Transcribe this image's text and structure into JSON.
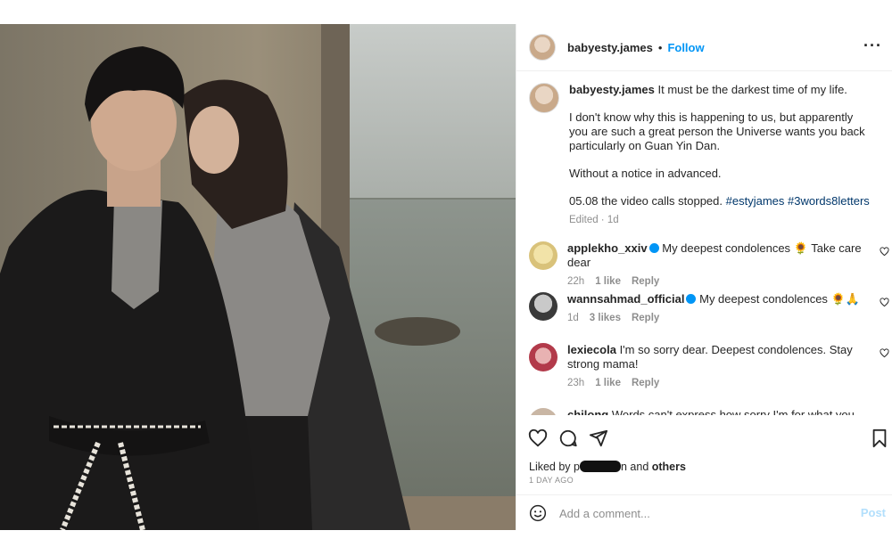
{
  "post": {
    "username": "babyesty.james",
    "follow_label": "Follow",
    "separator": "•",
    "more_label": "···"
  },
  "caption": {
    "username": "babyesty.james",
    "line1": "It must be the darkest time of my life.",
    "para2": "I don't know why this is happening to us, but apparently you are such a great person the Universe wants you back particularly on Guan Yin Dan.",
    "para3": "Without a notice in advanced.",
    "para4_text": "05.08 the video calls stopped.",
    "hashtag1": "#estyjames",
    "hashtag2": "#3words8letters",
    "meta": "Edited · 1d"
  },
  "comments": [
    {
      "username": "applekho_xxiv",
      "verified": true,
      "text": "My deepest condolences 🌻 Take care dear",
      "time": "22h",
      "likes": "1 like",
      "reply": "Reply"
    },
    {
      "username": "wannsahmad_official",
      "verified": true,
      "text": "My deepest condolences 🌻🙏",
      "time": "1d",
      "likes": "3 likes",
      "reply": "Reply"
    },
    {
      "username": "lexiecola",
      "verified": false,
      "text": "I'm so sorry dear. Deepest condolences. Stay strong mama!",
      "time": "23h",
      "likes": "1 like",
      "reply": "Reply"
    },
    {
      "username": "chilong",
      "verified": false,
      "text": "Words can't express how sorry I'm for what you are"
    }
  ],
  "likes": {
    "prefix": "Liked by ",
    "partial": "p",
    "suffix": "n and ",
    "others": "others"
  },
  "time_ago": "1 DAY AGO",
  "add_comment": {
    "placeholder": "Add a comment...",
    "post_label": "Post"
  },
  "colors": {
    "link": "#0095f6",
    "hashtag": "#00376b",
    "muted": "#8e8e8e"
  }
}
